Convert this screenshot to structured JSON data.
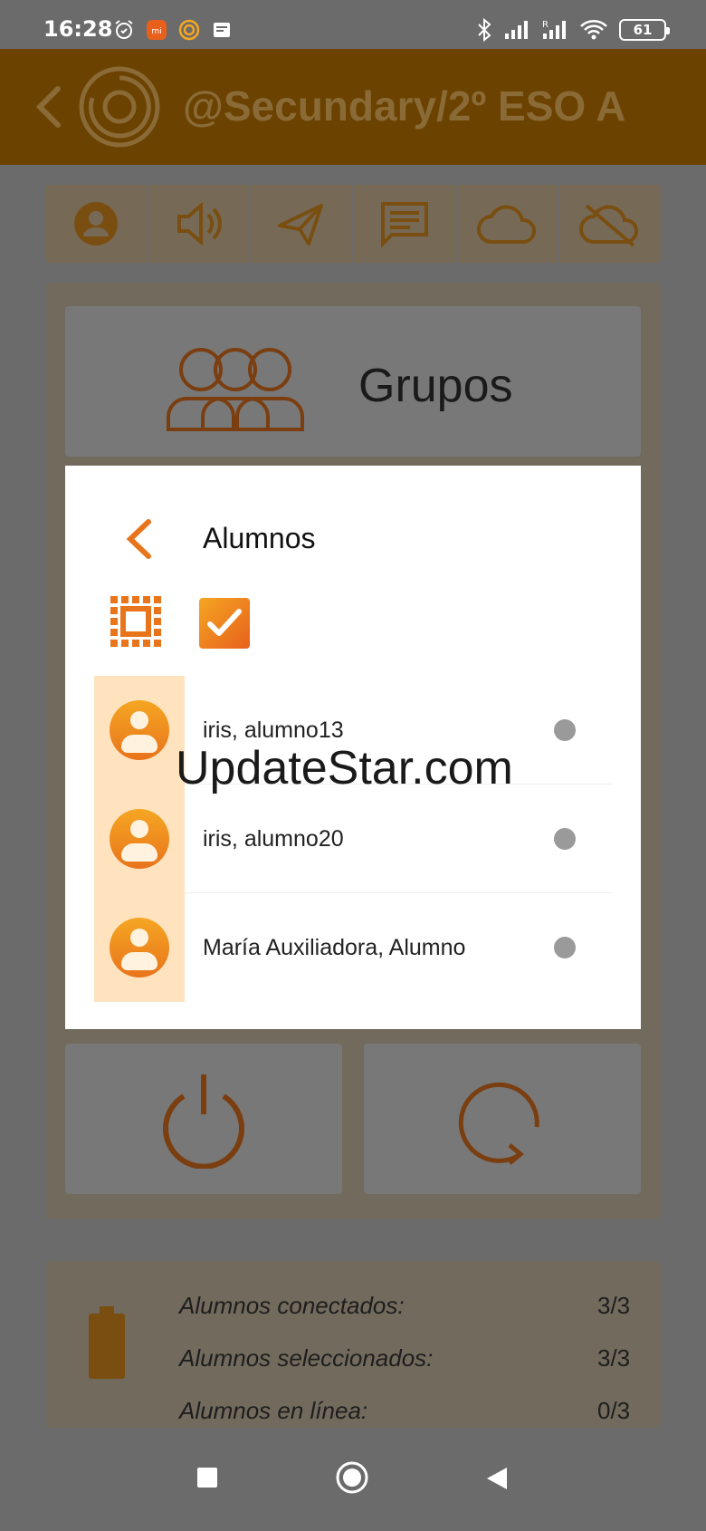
{
  "status_bar": {
    "time": "16:28",
    "battery": "61",
    "left_icons": [
      "alarm-icon",
      "mi-app-icon",
      "orange-app-icon",
      "message-icon"
    ],
    "right_icons": [
      "bluetooth-icon",
      "signal-icon",
      "signal-roaming-icon",
      "wifi-icon"
    ]
  },
  "header": {
    "title": "@Secundary/2º ESO A"
  },
  "toolbar": {
    "icons": [
      "user-icon",
      "speaker-icon",
      "send-icon",
      "chat-icon",
      "cloud-icon",
      "cloud-off-icon"
    ]
  },
  "main": {
    "grupos_label": "Grupos"
  },
  "dialog": {
    "title": "Alumnos",
    "students": [
      {
        "name": "iris, alumno13",
        "online": false
      },
      {
        "name": "iris, alumno20",
        "online": false
      },
      {
        "name": "María Auxiliadora, Alumno",
        "online": false
      }
    ]
  },
  "watermark": "UpdateStar.com",
  "stats": {
    "connected_label": "Alumnos conectados:",
    "connected_value": "3/3",
    "selected_label": "Alumnos seleccionados:",
    "selected_value": "3/3",
    "online_label": "Alumnos en línea:",
    "online_value": "0/3"
  },
  "colors": {
    "accent": "#e8741c",
    "accent_light": "#f5a623",
    "header_dim": "#6b4200",
    "avatar_bg": "#ffe3bf"
  }
}
